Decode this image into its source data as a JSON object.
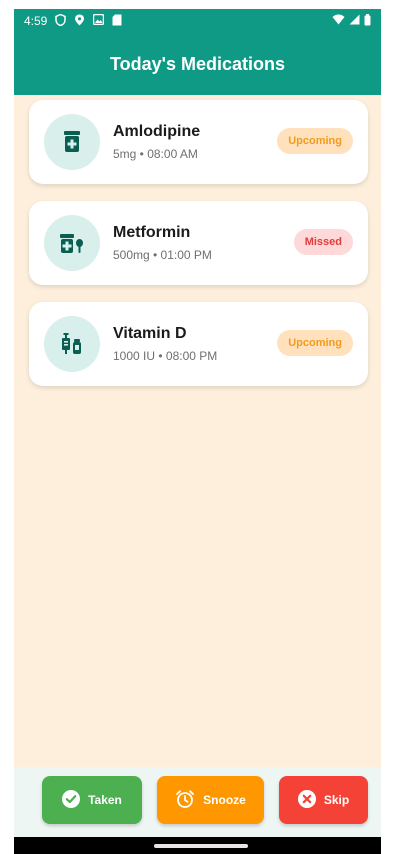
{
  "status_bar": {
    "time": "4:59",
    "left_icons": [
      "shield-check-icon",
      "location-pin-icon",
      "photo-icon",
      "sd-card-icon"
    ],
    "right_icons": [
      "wifi-icon",
      "signal-icon",
      "battery-icon"
    ]
  },
  "app_bar": {
    "title": "Today's Medications"
  },
  "medications": [
    {
      "name": "Amlodipine",
      "details": "5mg • 08:00 AM",
      "status": "Upcoming",
      "icon": "medicine-bottle-icon"
    },
    {
      "name": "Metformin",
      "details": "500mg • 01:00 PM",
      "status": "Missed",
      "icon": "pills-icon"
    },
    {
      "name": "Vitamin D",
      "details": "1000 IU • 08:00 PM",
      "status": "Upcoming",
      "icon": "vaccines-icon"
    }
  ],
  "actions": {
    "taken_label": "Taken",
    "snooze_label": "Snooze",
    "skip_label": "Skip"
  },
  "colors": {
    "primary": "#0f9a86",
    "background": "#fdefdc",
    "taken": "#4caf50",
    "snooze": "#ff9800",
    "skip": "#f44336",
    "upcoming_text": "#f39a1f",
    "missed_text": "#e33c3c"
  }
}
